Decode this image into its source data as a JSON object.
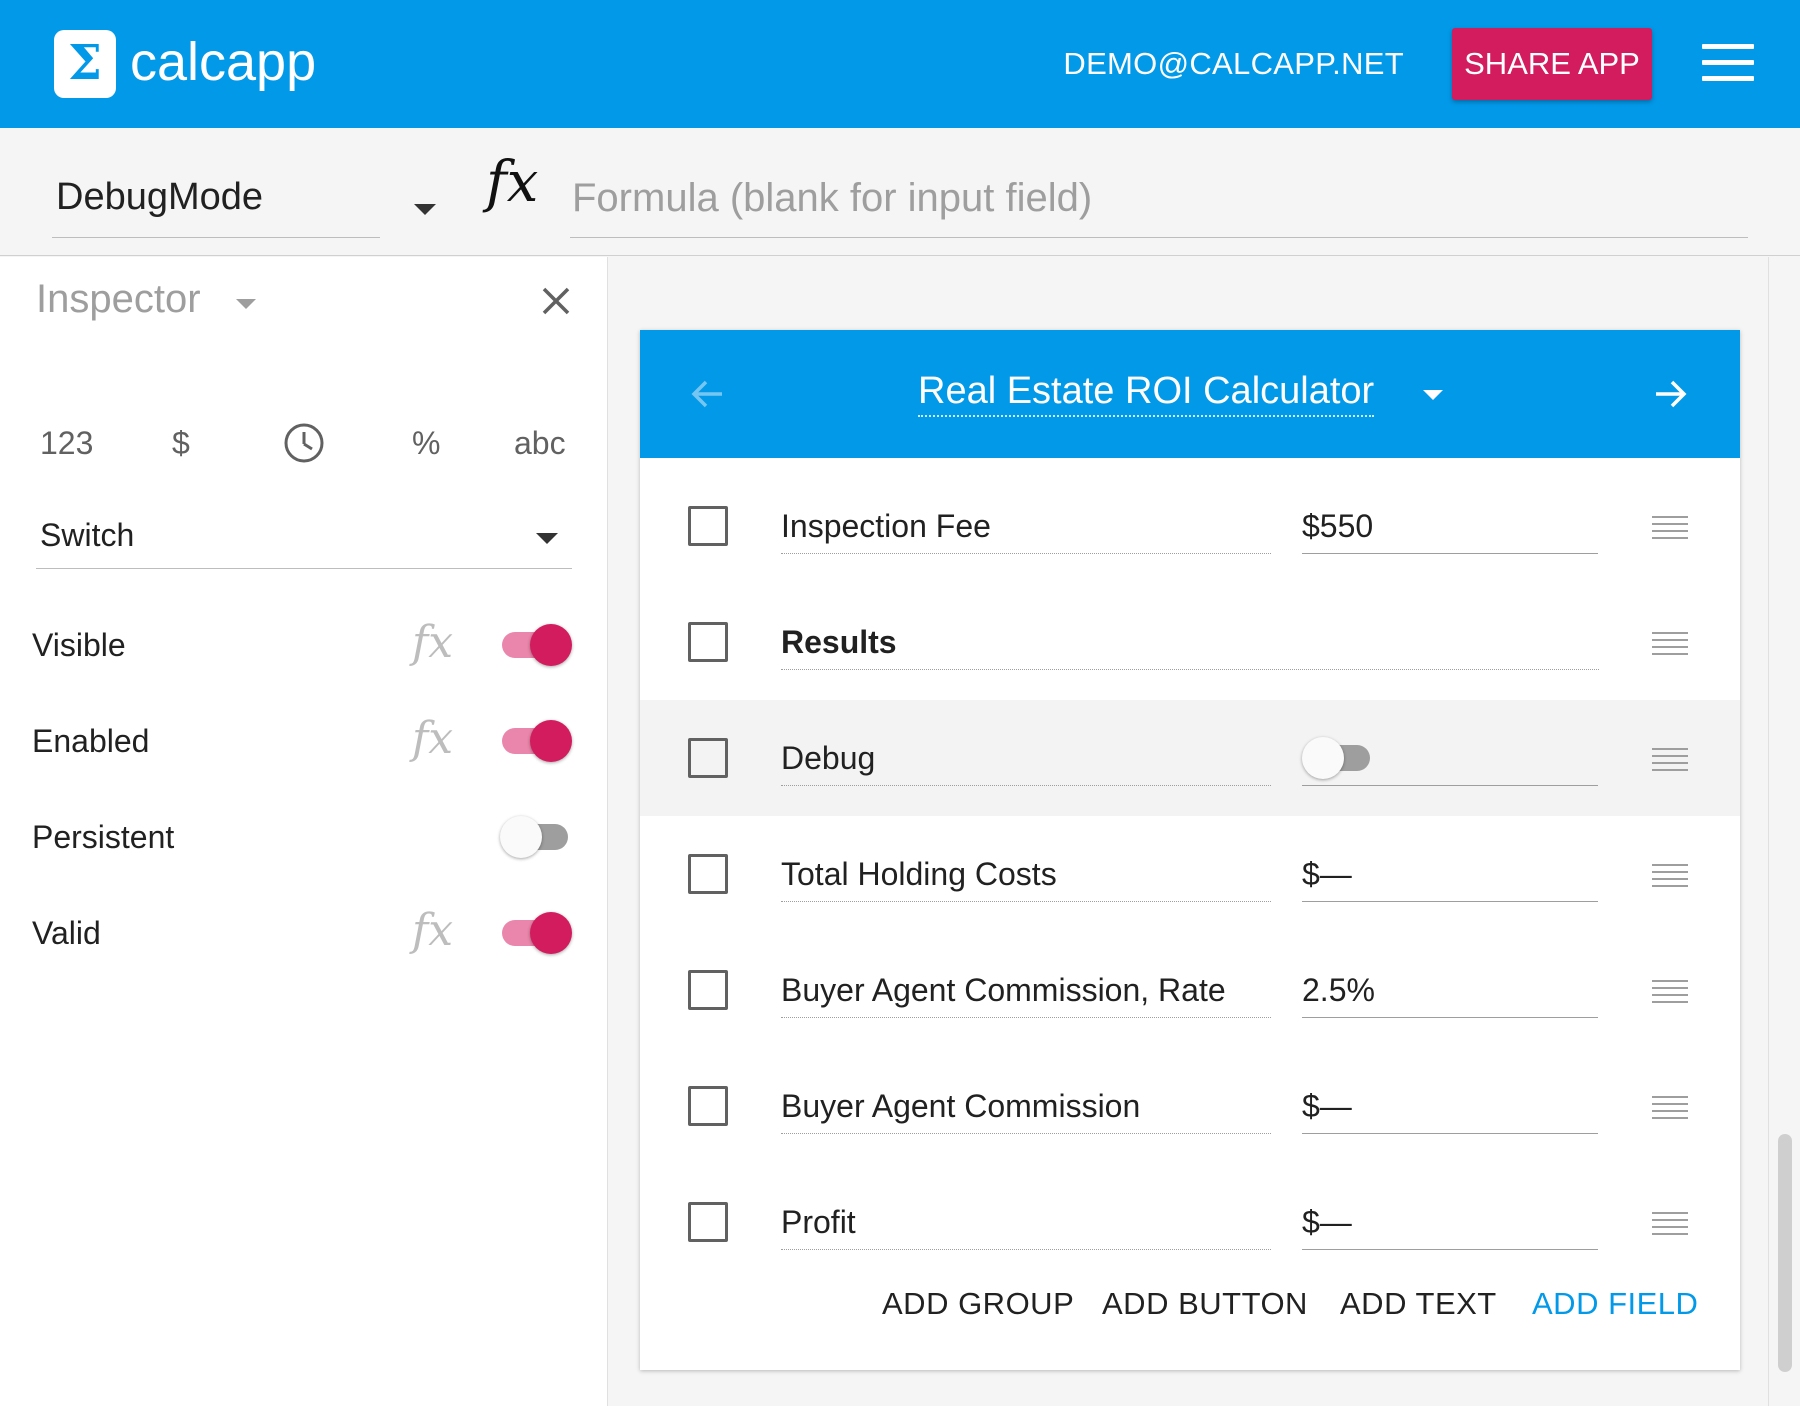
{
  "app": {
    "logo_symbol": "Σ",
    "name": "calcapp"
  },
  "header": {
    "user_email": "DEMO@CALCAPP.NET",
    "share_label": "SHARE APP",
    "menu_icon": "hamburger-menu-icon",
    "accent_color": "#0399e9",
    "share_color": "#d21c5d"
  },
  "formula_bar": {
    "selected_field": "DebugMode",
    "fx_label": "fx",
    "formula_placeholder": "Formula (blank for input field)"
  },
  "inspector": {
    "title": "Inspector",
    "type_icons": [
      {
        "label": "123",
        "icon": "number-type-icon"
      },
      {
        "label": "$",
        "icon": "currency-type-icon"
      },
      {
        "label": "",
        "icon": "clock-type-icon"
      },
      {
        "label": "%",
        "icon": "percent-type-icon"
      },
      {
        "label": "abc",
        "icon": "text-type-icon"
      }
    ],
    "field_type": "Switch",
    "properties": [
      {
        "label": "Visible",
        "has_formula": true,
        "on": true
      },
      {
        "label": "Enabled",
        "has_formula": true,
        "on": true
      },
      {
        "label": "Persistent",
        "has_formula": false,
        "on": false
      },
      {
        "label": "Valid",
        "has_formula": true,
        "on": true
      }
    ]
  },
  "card": {
    "title": "Real Estate ROI Calculator",
    "rows": [
      {
        "name": "Inspection Fee",
        "value": "$550"
      },
      {
        "name": "Results",
        "value": ""
      },
      {
        "name": "Debug",
        "value": "",
        "switch_on": false
      },
      {
        "name": "Total Holding Costs",
        "value": "$—"
      },
      {
        "name": "Buyer Agent Commission, Rate",
        "value": "2.5%"
      },
      {
        "name": "Buyer Agent Commission",
        "value": "$—"
      },
      {
        "name": "Profit",
        "value": "$—"
      }
    ],
    "actions": {
      "add_group": "ADD GROUP",
      "add_button": "ADD BUTTON",
      "add_text": "ADD TEXT",
      "add_field": "ADD FIELD"
    }
  }
}
